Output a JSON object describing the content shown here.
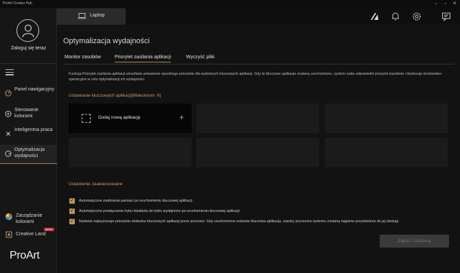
{
  "window": {
    "title": "ProArt Creator Hub"
  },
  "sidebar": {
    "login_label": "Zaloguj się teraz",
    "nav": [
      {
        "label": "Panel nawigacyjny",
        "icon": "dashboard-icon"
      },
      {
        "label": "Sterowanie kolorami",
        "icon": "color-control-icon"
      },
      {
        "label": "Inteligentna praca",
        "icon": "smart-work-icon"
      },
      {
        "label": "Optymalizacja wydajności",
        "icon": "performance-icon",
        "active": true
      }
    ],
    "bottom": [
      {
        "label": "Zarządzanie kolorami",
        "icon": "color-wheel-icon"
      },
      {
        "label": "Creative Land",
        "icon": "creative-land-icon",
        "badge": "NEW"
      }
    ],
    "logo_text": "ProArt"
  },
  "topbar": {
    "device_label": "Laptop",
    "icons": [
      "proart-logo-icon",
      "bell-icon",
      "gear-icon",
      "feedback-icon"
    ]
  },
  "main": {
    "title": "Optymalizacja wydajności",
    "tabs": [
      {
        "label": "Monitor zasobów"
      },
      {
        "label": "Priorytet zasilania aplikacji",
        "active": true
      },
      {
        "label": "Wyczyść pliki"
      }
    ],
    "description": "Funkcja Priorytet zasilania aplikacji umożliwia ustawienie wysokiego priorytetu dla wybranych kluczowych aplikacji. Gdy te kluczowe aplikacje zostaną uruchomione, system nada odpowiedni priorytet zasobom i dostosuje środowisko operacyjne w celu optymalizacji ich wydajności.",
    "key_apps_heading": "Ustawianie kluczowych aplikacji(Maksimum: 6)",
    "add_app_label": "Dodaj nową aplikację",
    "advanced_heading": "Ustawienie zaawansowane",
    "options": [
      {
        "label": "Automatyczne zwalnianie pamięci po uruchomieniu kluczowej aplikacji",
        "checked": true
      },
      {
        "label": "Automatyczne przełączanie trybu działania do trybu wydajności po uruchomieniu kluczowej aplikacji",
        "checked": true
      },
      {
        "label": "Nadanie najwyższego priorytetu obsłudze kluczowych aplikacji przez procesor. Gdy uruchomiona zostanie kluczowa aplikacja, zasoby procesora systemu zostaną najpierw przydzielone do jej obsługi.",
        "checked": true
      }
    ],
    "apply_label": "Zapisz i zastosuj"
  },
  "colors": {
    "accent": "#b08a5a",
    "heading": "#c89b6a",
    "badge": "#c4202a"
  }
}
